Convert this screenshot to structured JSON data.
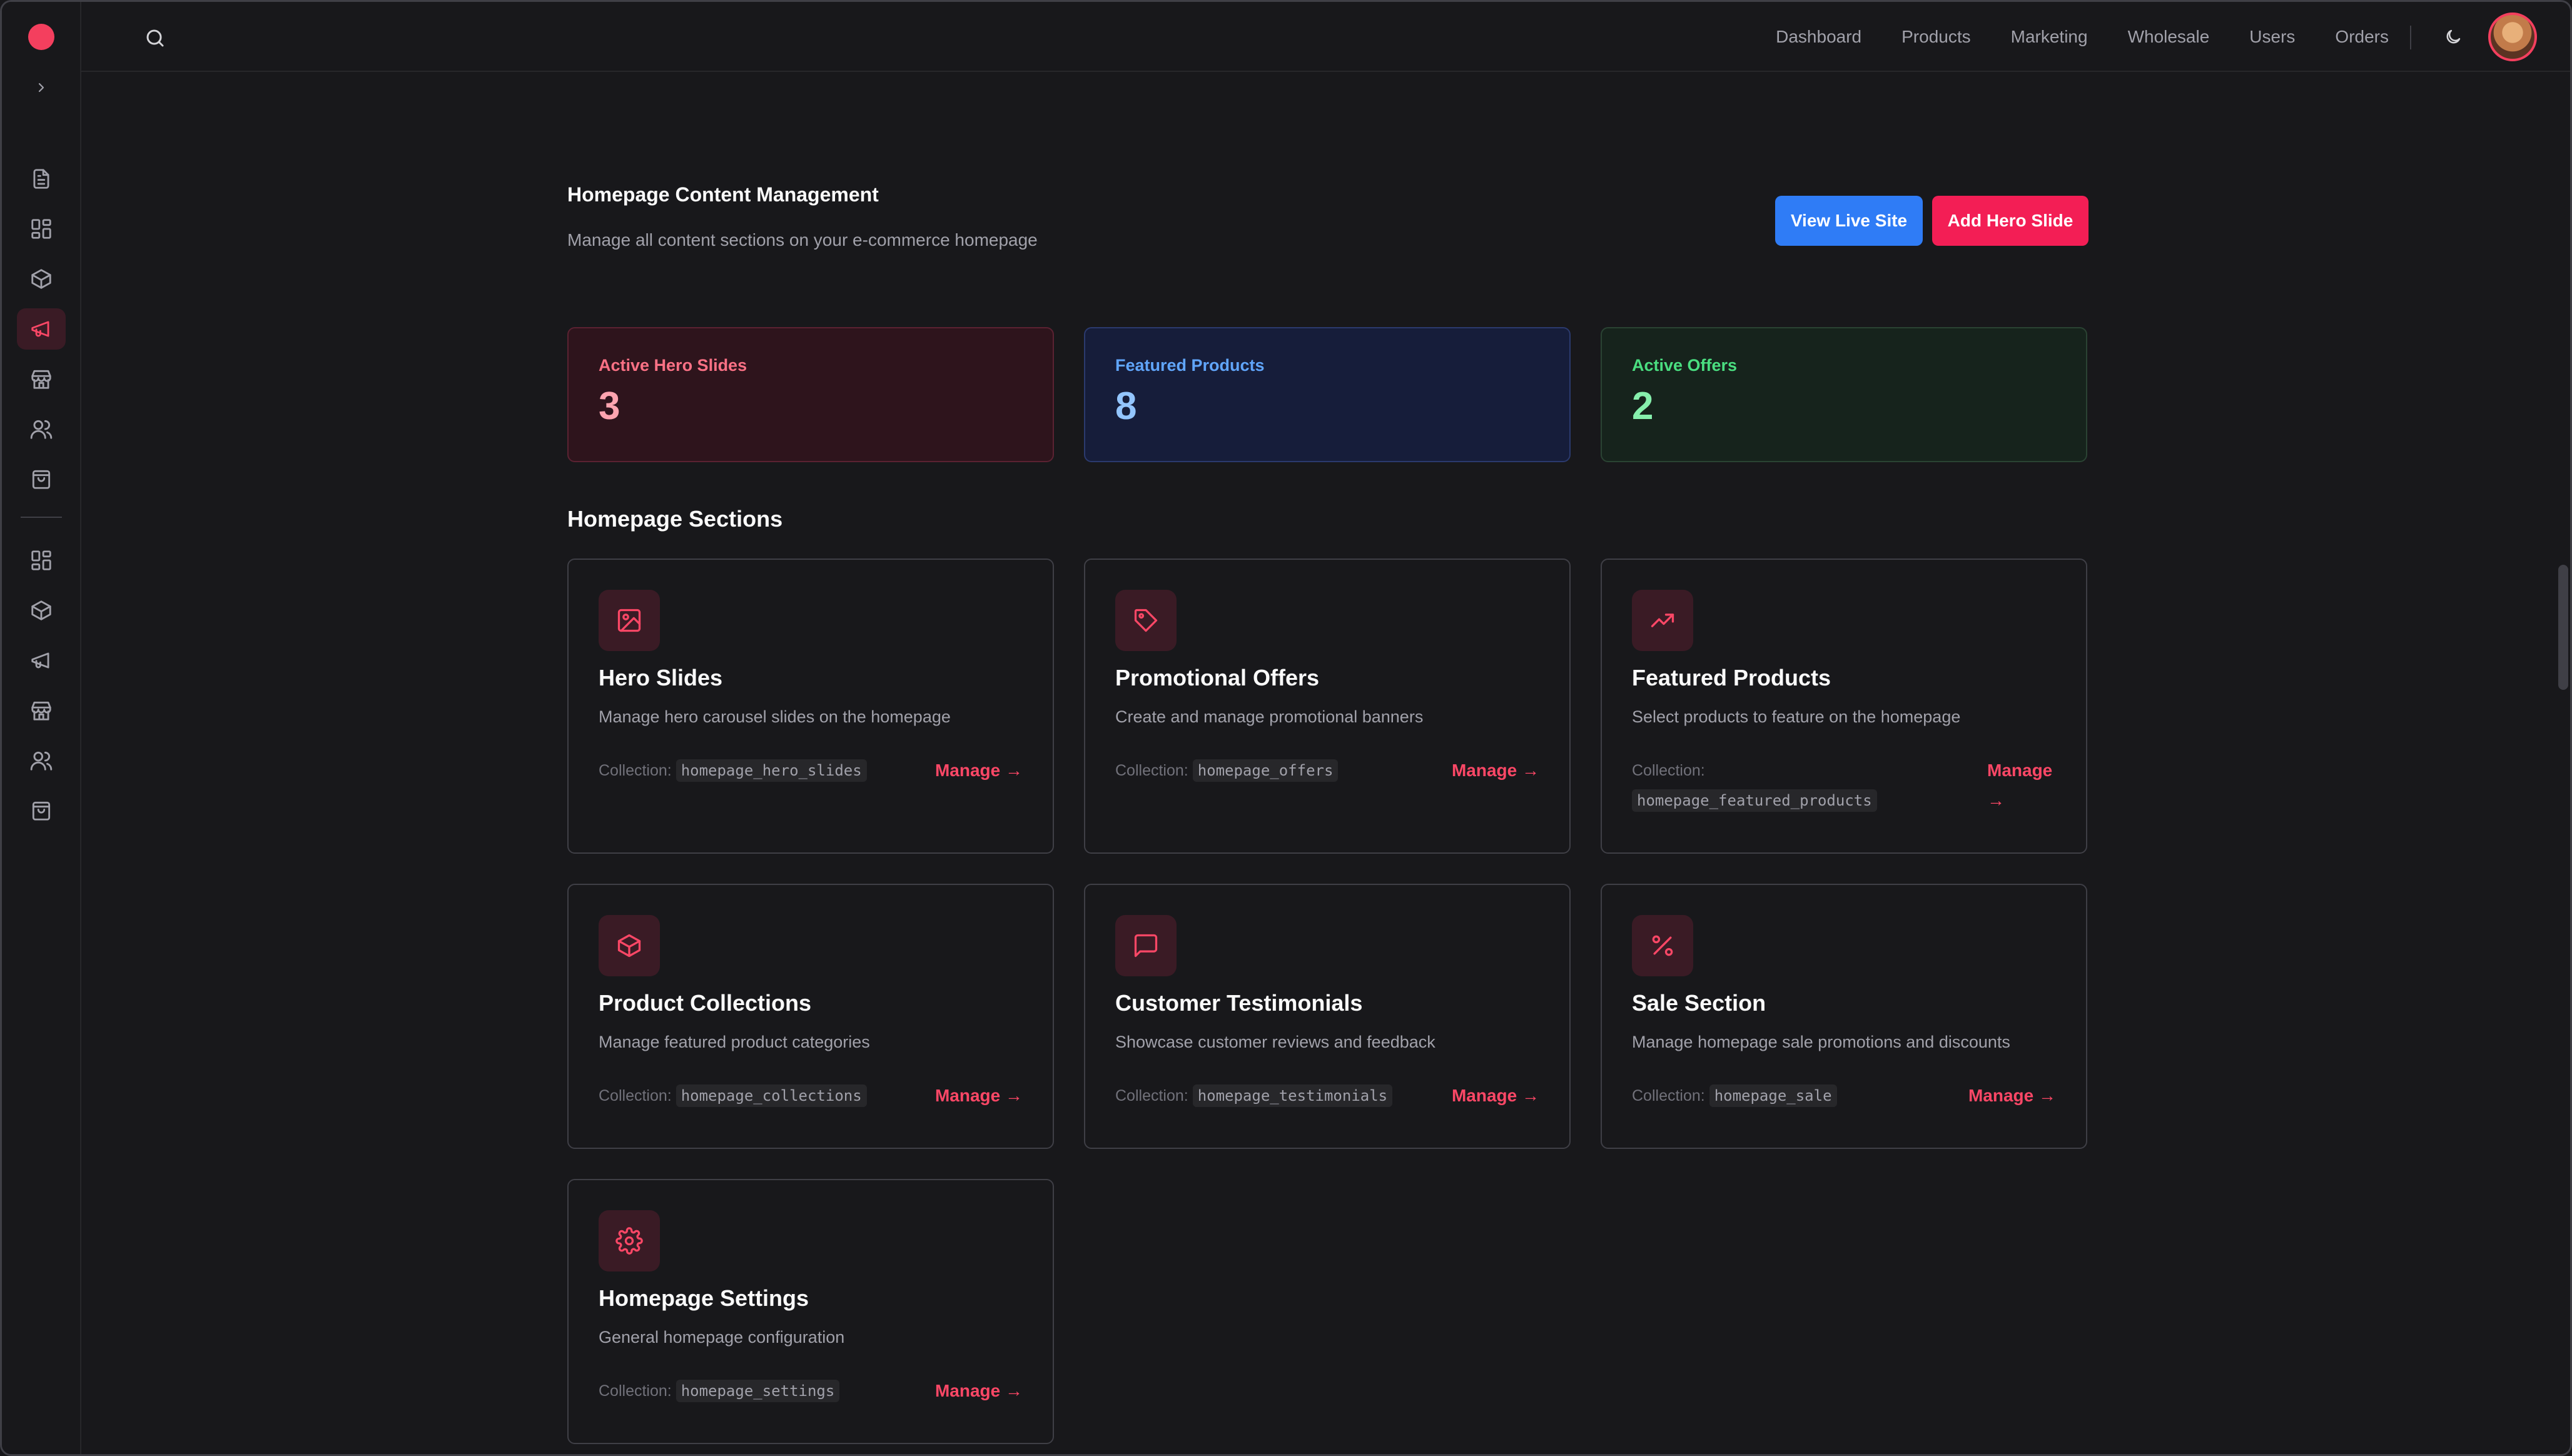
{
  "topnav": {
    "items": [
      "Dashboard",
      "Products",
      "Marketing",
      "Wholesale",
      "Users",
      "Orders"
    ]
  },
  "page": {
    "title": "Homepage Content Management",
    "subtitle": "Manage all content sections on your e-commerce homepage",
    "view_live_label": "View Live Site",
    "add_hero_label": "Add Hero Slide"
  },
  "stats": [
    {
      "label": "Active Hero Slides",
      "value": "3"
    },
    {
      "label": "Featured Products",
      "value": "8"
    },
    {
      "label": "Active Offers",
      "value": "2"
    }
  ],
  "sections": {
    "title": "Homepage Sections",
    "collection_label": "Collection:",
    "manage_label": "Manage →",
    "cards": [
      {
        "title": "Hero Slides",
        "desc": "Manage hero carousel slides on the homepage",
        "collection": "homepage_hero_slides",
        "icon": "image-icon"
      },
      {
        "title": "Promotional Offers",
        "desc": "Create and manage promotional banners",
        "collection": "homepage_offers",
        "icon": "tag-icon"
      },
      {
        "title": "Featured Products",
        "desc": "Select products to feature on the homepage",
        "collection": "homepage_featured_products",
        "icon": "trending-up-icon"
      },
      {
        "title": "Product Collections",
        "desc": "Manage featured product categories",
        "collection": "homepage_collections",
        "icon": "package-icon"
      },
      {
        "title": "Customer Testimonials",
        "desc": "Showcase customer reviews and feedback",
        "collection": "homepage_testimonials",
        "icon": "message-square-icon"
      },
      {
        "title": "Sale Section",
        "desc": "Manage homepage sale promotions and discounts",
        "collection": "homepage_sale",
        "icon": "percent-icon"
      },
      {
        "title": "Homepage Settings",
        "desc": "General homepage configuration",
        "collection": "homepage_settings",
        "icon": "gear-icon"
      }
    ]
  },
  "colors": {
    "accent": "#f31e55",
    "primary_blue": "#2f7cf6",
    "background": "#18181b"
  }
}
